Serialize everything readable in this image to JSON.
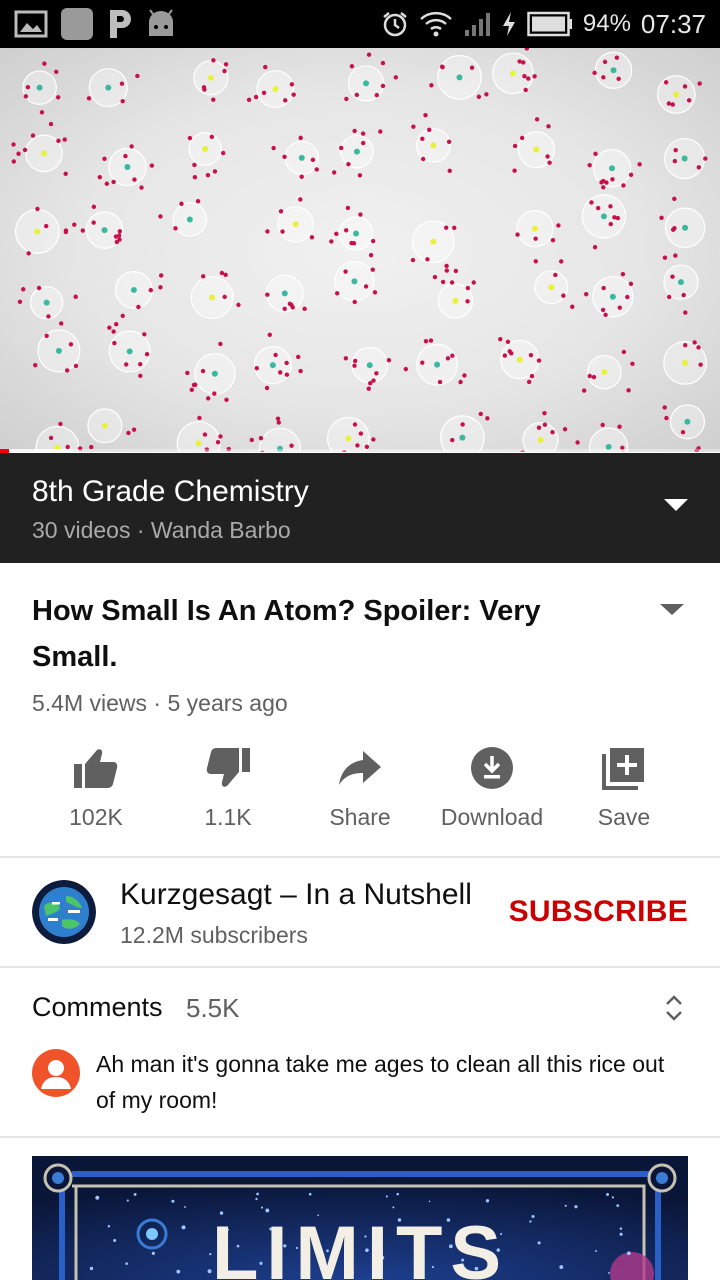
{
  "status_bar": {
    "battery": "94%",
    "time": "07:37",
    "left_icons": [
      "gallery-icon",
      "app-icon",
      "p-app-icon",
      "android-icon"
    ],
    "right_icons": [
      "alarm-icon",
      "wifi-icon",
      "signal-icon",
      "charging-icon",
      "battery-icon"
    ]
  },
  "player": {
    "progress_fraction": 0.012,
    "buffer_fraction": 0.1
  },
  "playlist": {
    "title": "8th Grade Chemistry",
    "meta": "30 videos · Wanda Barbo"
  },
  "video": {
    "title": "How Small Is An Atom? Spoiler: Very Small.",
    "meta": "5.4M views · 5 years ago"
  },
  "actions": [
    {
      "label": "102K",
      "icon": "thumb-up-icon"
    },
    {
      "label": "1.1K",
      "icon": "thumb-down-icon"
    },
    {
      "label": "Share",
      "icon": "share-icon"
    },
    {
      "label": "Download",
      "icon": "download-icon"
    },
    {
      "label": "Save",
      "icon": "playlist-add-icon"
    }
  ],
  "channel": {
    "name": "Kurzgesagt – In a Nutshell",
    "subscribers": "12.2M subscribers",
    "subscribe_label": "SUBSCRIBE"
  },
  "comments": {
    "label": "Comments",
    "count": "5.5K",
    "top_comment": "Ah man it's gonna take me ages to clean all this rice out of my room!"
  },
  "next_video": {
    "thumbnail_text": "LIMITS"
  },
  "colors": {
    "accent_red": "#cc0000",
    "progress_red": "#ff0000",
    "playlist_bg": "#212121",
    "comment_avatar": "#f0522a"
  }
}
